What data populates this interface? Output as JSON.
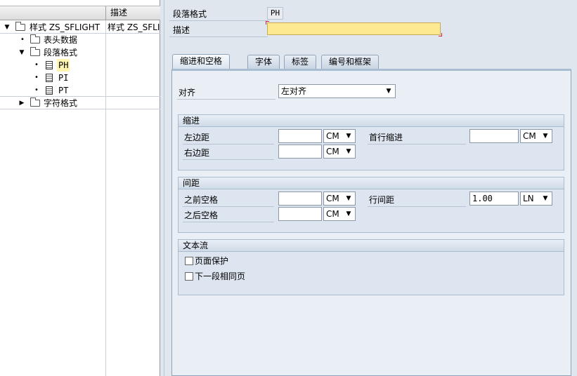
{
  "tree": {
    "column_header": "描述",
    "nodes": [
      {
        "label": "样式 ZS_SFLIGHT",
        "desc": "样式 ZS_SFLI"
      },
      {
        "label": "表头数据"
      },
      {
        "label": "段落格式"
      },
      {
        "label": "PH"
      },
      {
        "label": "PI"
      },
      {
        "label": "PT"
      },
      {
        "label": "字符格式"
      }
    ]
  },
  "header": {
    "paragraph_format_label": "段落格式",
    "paragraph_format_value": "PH",
    "description_label": "描述",
    "description_value": ""
  },
  "tabs": [
    {
      "label": "缩进和空格",
      "active": true
    },
    {
      "label": "字体",
      "active": false
    },
    {
      "label": "标签",
      "active": false
    },
    {
      "label": "编号和框架",
      "active": false
    }
  ],
  "alignment": {
    "label": "对齐",
    "value": "左对齐"
  },
  "indent": {
    "title": "缩进",
    "left_margin_label": "左边距",
    "left_margin_value": "",
    "left_margin_unit": "CM",
    "right_margin_label": "右边距",
    "right_margin_value": "",
    "right_margin_unit": "CM",
    "first_line_label": "首行缩进",
    "first_line_value": "",
    "first_line_unit": "CM"
  },
  "spacing": {
    "title": "间距",
    "before_label": "之前空格",
    "before_value": "",
    "before_unit": "CM",
    "after_label": "之后空格",
    "after_value": "",
    "after_unit": "CM",
    "line_spacing_label": "行间距",
    "line_spacing_value": "1.00",
    "line_spacing_unit": "LN"
  },
  "textflow": {
    "title": "文本流",
    "page_protection_label": "页面保护",
    "page_protection_checked": false,
    "next_para_same_page_label": "下一段相同页",
    "next_para_same_page_checked": false
  }
}
